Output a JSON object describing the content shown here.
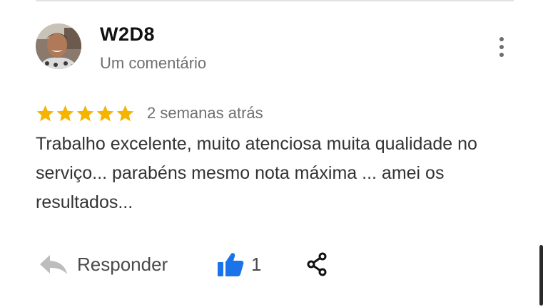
{
  "review": {
    "reviewer_name": "W2D8",
    "reviewer_meta": "Um comentário",
    "rating": 5,
    "rating_max": 5,
    "date": "2 semanas atrás",
    "text": "Trabalho excelente, muito atenciosa muita qualidade no serviço... parabéns mesmo nota máxima ... amei os resultados..."
  },
  "actions": {
    "reply_label": "Responder",
    "like_count": "1"
  },
  "colors": {
    "star": "#F4B400",
    "like": "#1A73E8",
    "reply_icon": "#BDBDBD"
  },
  "icons": {
    "more": "more-vert-icon",
    "star": "star-icon",
    "reply": "reply-arrow-icon",
    "like": "thumbs-up-icon",
    "share": "share-icon"
  }
}
